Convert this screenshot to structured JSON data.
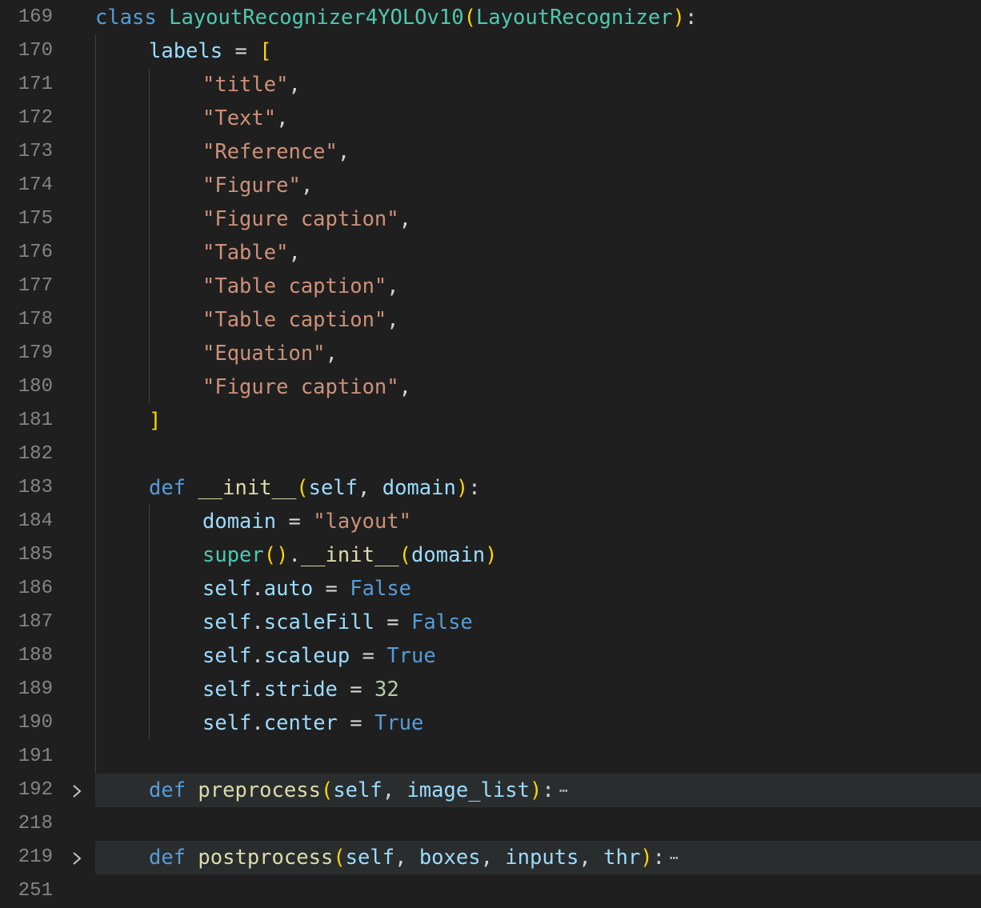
{
  "editor": {
    "language": "python",
    "lines": [
      {
        "num": "169",
        "indent": 0,
        "tokens": [
          {
            "t": "class ",
            "c": "kw"
          },
          {
            "t": "LayoutRecognizer4YOLOv10",
            "c": "cls"
          },
          {
            "t": "(",
            "c": "p1"
          },
          {
            "t": "LayoutRecognizer",
            "c": "cls"
          },
          {
            "t": ")",
            "c": "p1"
          },
          {
            "t": ":",
            "c": "pl"
          }
        ]
      },
      {
        "num": "170",
        "indent": 1,
        "tokens": [
          {
            "t": "labels",
            "c": "var"
          },
          {
            "t": " = ",
            "c": "pl"
          },
          {
            "t": "[",
            "c": "p1"
          }
        ]
      },
      {
        "num": "171",
        "indent": 2,
        "tokens": [
          {
            "t": "\"title\"",
            "c": "str"
          },
          {
            "t": ",",
            "c": "pl"
          }
        ]
      },
      {
        "num": "172",
        "indent": 2,
        "tokens": [
          {
            "t": "\"Text\"",
            "c": "str"
          },
          {
            "t": ",",
            "c": "pl"
          }
        ]
      },
      {
        "num": "173",
        "indent": 2,
        "tokens": [
          {
            "t": "\"Reference\"",
            "c": "str"
          },
          {
            "t": ",",
            "c": "pl"
          }
        ]
      },
      {
        "num": "174",
        "indent": 2,
        "tokens": [
          {
            "t": "\"Figure\"",
            "c": "str"
          },
          {
            "t": ",",
            "c": "pl"
          }
        ]
      },
      {
        "num": "175",
        "indent": 2,
        "tokens": [
          {
            "t": "\"Figure caption\"",
            "c": "str"
          },
          {
            "t": ",",
            "c": "pl"
          }
        ]
      },
      {
        "num": "176",
        "indent": 2,
        "tokens": [
          {
            "t": "\"Table\"",
            "c": "str"
          },
          {
            "t": ",",
            "c": "pl"
          }
        ]
      },
      {
        "num": "177",
        "indent": 2,
        "tokens": [
          {
            "t": "\"Table caption\"",
            "c": "str"
          },
          {
            "t": ",",
            "c": "pl"
          }
        ]
      },
      {
        "num": "178",
        "indent": 2,
        "tokens": [
          {
            "t": "\"Table caption\"",
            "c": "str"
          },
          {
            "t": ",",
            "c": "pl"
          }
        ]
      },
      {
        "num": "179",
        "indent": 2,
        "tokens": [
          {
            "t": "\"Equation\"",
            "c": "str"
          },
          {
            "t": ",",
            "c": "pl"
          }
        ]
      },
      {
        "num": "180",
        "indent": 2,
        "tokens": [
          {
            "t": "\"Figure caption\"",
            "c": "str"
          },
          {
            "t": ",",
            "c": "pl"
          }
        ]
      },
      {
        "num": "181",
        "indent": 1,
        "tokens": [
          {
            "t": "]",
            "c": "p1"
          }
        ]
      },
      {
        "num": "182",
        "indent": 0,
        "tokens": []
      },
      {
        "num": "183",
        "indent": 1,
        "tokens": [
          {
            "t": "def ",
            "c": "kw"
          },
          {
            "t": "__init__",
            "c": "fn"
          },
          {
            "t": "(",
            "c": "p1"
          },
          {
            "t": "self",
            "c": "var"
          },
          {
            "t": ", ",
            "c": "pl"
          },
          {
            "t": "domain",
            "c": "var"
          },
          {
            "t": ")",
            "c": "p1"
          },
          {
            "t": ":",
            "c": "pl"
          }
        ]
      },
      {
        "num": "184",
        "indent": 2,
        "tokens": [
          {
            "t": "domain",
            "c": "var"
          },
          {
            "t": " = ",
            "c": "pl"
          },
          {
            "t": "\"layout\"",
            "c": "str"
          }
        ]
      },
      {
        "num": "185",
        "indent": 2,
        "tokens": [
          {
            "t": "super",
            "c": "cls"
          },
          {
            "t": "()",
            "c": "p1"
          },
          {
            "t": ".",
            "c": "pl"
          },
          {
            "t": "__init__",
            "c": "fn"
          },
          {
            "t": "(",
            "c": "p1"
          },
          {
            "t": "domain",
            "c": "var"
          },
          {
            "t": ")",
            "c": "p1"
          }
        ]
      },
      {
        "num": "186",
        "indent": 2,
        "tokens": [
          {
            "t": "self",
            "c": "var"
          },
          {
            "t": ".",
            "c": "pl"
          },
          {
            "t": "auto",
            "c": "var"
          },
          {
            "t": " = ",
            "c": "pl"
          },
          {
            "t": "False",
            "c": "kw"
          }
        ]
      },
      {
        "num": "187",
        "indent": 2,
        "tokens": [
          {
            "t": "self",
            "c": "var"
          },
          {
            "t": ".",
            "c": "pl"
          },
          {
            "t": "scaleFill",
            "c": "var"
          },
          {
            "t": " = ",
            "c": "pl"
          },
          {
            "t": "False",
            "c": "kw"
          }
        ]
      },
      {
        "num": "188",
        "indent": 2,
        "tokens": [
          {
            "t": "self",
            "c": "var"
          },
          {
            "t": ".",
            "c": "pl"
          },
          {
            "t": "scaleup",
            "c": "var"
          },
          {
            "t": " = ",
            "c": "pl"
          },
          {
            "t": "True",
            "c": "kw"
          }
        ]
      },
      {
        "num": "189",
        "indent": 2,
        "tokens": [
          {
            "t": "self",
            "c": "var"
          },
          {
            "t": ".",
            "c": "pl"
          },
          {
            "t": "stride",
            "c": "var"
          },
          {
            "t": " = ",
            "c": "pl"
          },
          {
            "t": "32",
            "c": "num"
          }
        ]
      },
      {
        "num": "190",
        "indent": 2,
        "tokens": [
          {
            "t": "self",
            "c": "var"
          },
          {
            "t": ".",
            "c": "pl"
          },
          {
            "t": "center",
            "c": "var"
          },
          {
            "t": " = ",
            "c": "pl"
          },
          {
            "t": "True",
            "c": "kw"
          }
        ]
      },
      {
        "num": "191",
        "indent": 0,
        "tokens": []
      },
      {
        "num": "192",
        "indent": 1,
        "folded": true,
        "tokens": [
          {
            "t": "def ",
            "c": "kw"
          },
          {
            "t": "preprocess",
            "c": "fn"
          },
          {
            "t": "(",
            "c": "p1"
          },
          {
            "t": "self",
            "c": "var"
          },
          {
            "t": ", ",
            "c": "pl"
          },
          {
            "t": "image_list",
            "c": "var"
          },
          {
            "t": ")",
            "c": "p1"
          },
          {
            "t": ":",
            "c": "pl"
          }
        ]
      },
      {
        "num": "218",
        "indent": 0,
        "tokens": []
      },
      {
        "num": "219",
        "indent": 1,
        "folded": true,
        "tokens": [
          {
            "t": "def ",
            "c": "kw"
          },
          {
            "t": "postprocess",
            "c": "fn"
          },
          {
            "t": "(",
            "c": "p1"
          },
          {
            "t": "self",
            "c": "var"
          },
          {
            "t": ", ",
            "c": "pl"
          },
          {
            "t": "boxes",
            "c": "var"
          },
          {
            "t": ", ",
            "c": "pl"
          },
          {
            "t": "inputs",
            "c": "var"
          },
          {
            "t": ", ",
            "c": "pl"
          },
          {
            "t": "thr",
            "c": "var"
          },
          {
            "t": ")",
            "c": "p1"
          },
          {
            "t": ":",
            "c": "pl"
          }
        ]
      },
      {
        "num": "251",
        "indent": 0,
        "tokens": []
      }
    ],
    "fold_icon": "chevron-right-icon",
    "ellipsis_icon": "ellipsis-icon",
    "fold_glyph": "›",
    "ellipsis_glyph": "⋯"
  }
}
